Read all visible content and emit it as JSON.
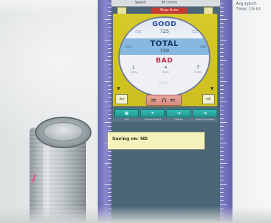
{
  "header": {
    "speed_label": "Speed",
    "speed_value": "38 tr/min",
    "stop_auto_label": "Stop Auto"
  },
  "counters": {
    "good_label": "GOOD",
    "good_value": "725",
    "good_left": "725",
    "good_right": "721",
    "total_label": "TOTAL",
    "total_value": "729",
    "total_left": "124",
    "total_right": "730",
    "bad_label": "BAD",
    "bad_left": "1",
    "bad_center": "4",
    "bad_right": "7",
    "bad_left_sub": "1 pics",
    "bad_center_sub": "3 pics",
    "bad_right_sub": "6 pics",
    "misc_small": "2f pt(s)"
  },
  "buttons": {
    "set_label": "Set",
    "forced_import_label": "Forced Import",
    "delete_label": "Delete",
    "check_symbols_label": "Check Symbols"
  },
  "status": {
    "saving_message": "Saving on: HD"
  },
  "monitor": {
    "line1": "Arg synch",
    "line2": "Time: 10:52"
  },
  "icons": {
    "left_arrow": "left-arrow-icon",
    "right_arrow": "right-arrow-icon",
    "rotate_left": "rotate-left-icon",
    "rotate_right": "rotate-right-icon",
    "eye": "eye-icon",
    "link": "link-icon"
  },
  "colors": {
    "panel_yellow": "#d7c92a",
    "stop_red": "#c53a34",
    "total_blue": "#88b8de",
    "good_text": "#274e9d",
    "bad_text": "#c0314e",
    "teal_button": "#1d9b94",
    "ruler_purple": "#7f7cc6"
  }
}
